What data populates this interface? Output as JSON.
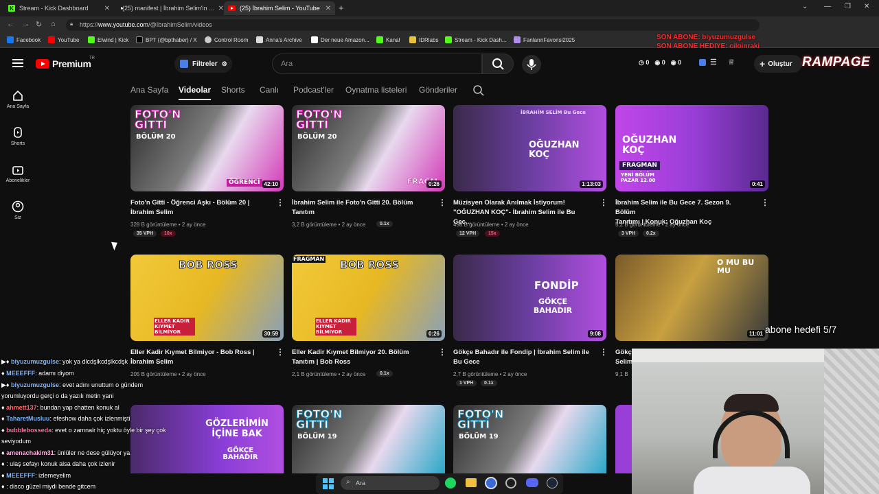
{
  "browser": {
    "tabs": [
      {
        "title": "Stream - Kick Dashboard",
        "icon": "kick-icon"
      },
      {
        "title": "(25) manifest | İbrahim Selim'in ...",
        "icon": "youtube-icon"
      },
      {
        "title": "(25) İbrahim Selim - YouTube",
        "icon": "youtube-icon"
      }
    ],
    "new_tab": "+",
    "url_prefix": "https://",
    "url_host": "www.youtube.com",
    "url_path": "/@IbrahimSelim/videos",
    "bookmarks": [
      "Facebook",
      "YouTube",
      "Elwind | Kick",
      "BPT (@bpthaber) / X",
      "Control Room",
      "Anna's Archive",
      "Der neue Amazon...",
      "Kanal",
      "IDRlabs",
      "Stream - Kick Dash...",
      "FanlarınFavorisi2025"
    ]
  },
  "overlay": {
    "goal_line1": "SON ABONE: biyuzumuzgulse",
    "goal_line2": "SON ABONE HEDIYE: cilginraki",
    "brand": "RAMPAGE",
    "sub_goal": "abone hedefi 5/7"
  },
  "yt": {
    "logo": "Premium",
    "region": "TR",
    "filters": "Filtreler",
    "search_placeholder": "Ara",
    "counters": [
      "0",
      "0",
      "0"
    ],
    "create": "Oluştur",
    "sidebar": [
      "Ana Sayfa",
      "Shorts",
      "Abonelikler",
      "Siz"
    ],
    "tabs": [
      "Ana Sayfa",
      "Videolar",
      "Shorts",
      "Canlı",
      "Podcast'ler",
      "Oynatma listeleri",
      "Gönderiler"
    ]
  },
  "videos": [
    {
      "title1": "Foto'n Gitti - Öğrenci Aşkı - Bölüm 20 |",
      "title2": "İbrahim Selim",
      "meta": "328 B görüntüleme • 2 ay önce",
      "vph": "35 VPH",
      "ratio": "10x",
      "duration": "42:10",
      "thumb_text": "FOTO'N GİTTİ",
      "thumb_sub": "BÖLÜM 20",
      "tag": "ÖĞRENCİ"
    },
    {
      "title1": "İbrahim Selim ile Foto'n Gitti 20. Bölüm",
      "title2": "Tanıtım",
      "meta": "3,2 B görüntüleme • 2 ay önce",
      "vph": "",
      "ratio": "0.1x",
      "duration": "0:26",
      "thumb_text": "FOTO'N GİTTİ",
      "thumb_sub": "BÖLÜM 20",
      "tag": "FRAGM"
    },
    {
      "title1": "Müzisyen Olarak Anılmak İstiyorum!",
      "title2": "\"OĞUZHAN KOÇ\"- İbrahim Selim ile Bu Gec...",
      "meta": "498 B görüntüleme • 2 ay önce",
      "vph": "12 VPH",
      "ratio": "15x",
      "duration": "1:13:03",
      "thumb_text": "OĞUZHAN KOÇ",
      "thumb_sub": "İBRAHİM SELİM Bu Gece",
      "tag": ""
    },
    {
      "title1": "İbrahim Selim ile Bu Gece 7. Sezon 9. Bölüm",
      "title2": "Tanıtımı | Konuk: Oğuzhan Koç",
      "meta": "5,2 B görüntüleme • 2 ay önce",
      "vph": "3 VPH",
      "ratio": "0.2x",
      "duration": "0:41",
      "thumb_text": "OĞUZHAN KOÇ",
      "thumb_sub": "FRAGMAN",
      "tag": "YENİ BÖLÜM PAZAR 12.00"
    },
    {
      "title1": "Eller Kadir Kıymet Bilmiyor - Bob Ross |",
      "title2": "İbrahim Selim",
      "meta": "205 B görüntüleme • 2 ay önce",
      "vph": "",
      "ratio": "",
      "duration": "30:59",
      "thumb_text": "BOB ROSS",
      "thumb_sub": "ELLER KADIR KIYMET BİLMİYOR",
      "tag": ""
    },
    {
      "title1": "Eller Kadir Kıymet Bilmiyor 20. Bölüm",
      "title2": "Tanıtım | Bob Ross",
      "meta": "2,1 B görüntüleme • 2 ay önce",
      "vph": "",
      "ratio": "0.1x",
      "duration": "0:26",
      "thumb_text": "BOB ROSS",
      "thumb_sub": "ELLER KADIR KIYMET BİLMİYOR",
      "tag": "FRAGMAN"
    },
    {
      "title1": "Gökçe Bahadır ile Fondip | İbrahim Selim ile",
      "title2": "Bu Gece",
      "meta": "2,7 B görüntüleme • 2 ay önce",
      "vph": "1 VPH",
      "ratio": "0.1x",
      "duration": "9:08",
      "thumb_text": "FONDİP",
      "thumb_sub": "GÖKÇE BAHADIR",
      "tag": ""
    },
    {
      "title1": "Gökç",
      "title2": "Selim",
      "meta": "9,1 B",
      "vph": "",
      "ratio": "",
      "duration": "11:01",
      "thumb_text": "O MU BU MU",
      "thumb_sub": "",
      "tag": ""
    },
    {
      "thumb_text": "GÖZLERİMİN İÇİNE BAK",
      "thumb_sub": "GÖKÇE BAHADIR"
    },
    {
      "thumb_text": "FOTO'N GİTTİ",
      "thumb_sub": "BÖLÜM 19"
    },
    {
      "thumb_text": "FOTO'N GİTTİ",
      "thumb_sub": "BÖLÜM 19"
    }
  ],
  "chat": [
    {
      "user": "biyuzumuzgulse",
      "msg": ": yok ya dlcdşlkcdşlkcdşk"
    },
    {
      "user": "MEEEFFF",
      "msg": ": adamı diyom"
    },
    {
      "user": "biyuzumuzgulse",
      "msg": ": evet adını unuttum o gündem"
    },
    {
      "user": "",
      "msg": "yorumluyordu gerçi o da yazılı metin yani"
    },
    {
      "user": "ahmett137",
      "msg": ": bundan yap chatten konuk al"
    },
    {
      "user": "TaharetMusluu",
      "msg": ": efeshow daha çok izlenmişti"
    },
    {
      "user": "bubblebosseda",
      "msg": ": evet o zamnalr hiç yoktu öyle bir şey çok"
    },
    {
      "user": "",
      "msg": "seviyodum"
    },
    {
      "user": "amenachakim31",
      "msg": ": ünlüler ne dese gülüyor ya"
    },
    {
      "user": "",
      "msg": ": ulaş sefayı konuk alsa daha çok izlenir"
    },
    {
      "user": "MEEEFFF",
      "msg": ": izlemeyelim"
    },
    {
      "user": "",
      "msg": ": disco güzel miydi bende gitcem"
    }
  ],
  "taskbar": {
    "search": "Ara"
  },
  "colors": {
    "yt_red": "#ff0000",
    "kick_green": "#53fc18",
    "brand_red": "#e0202a"
  }
}
